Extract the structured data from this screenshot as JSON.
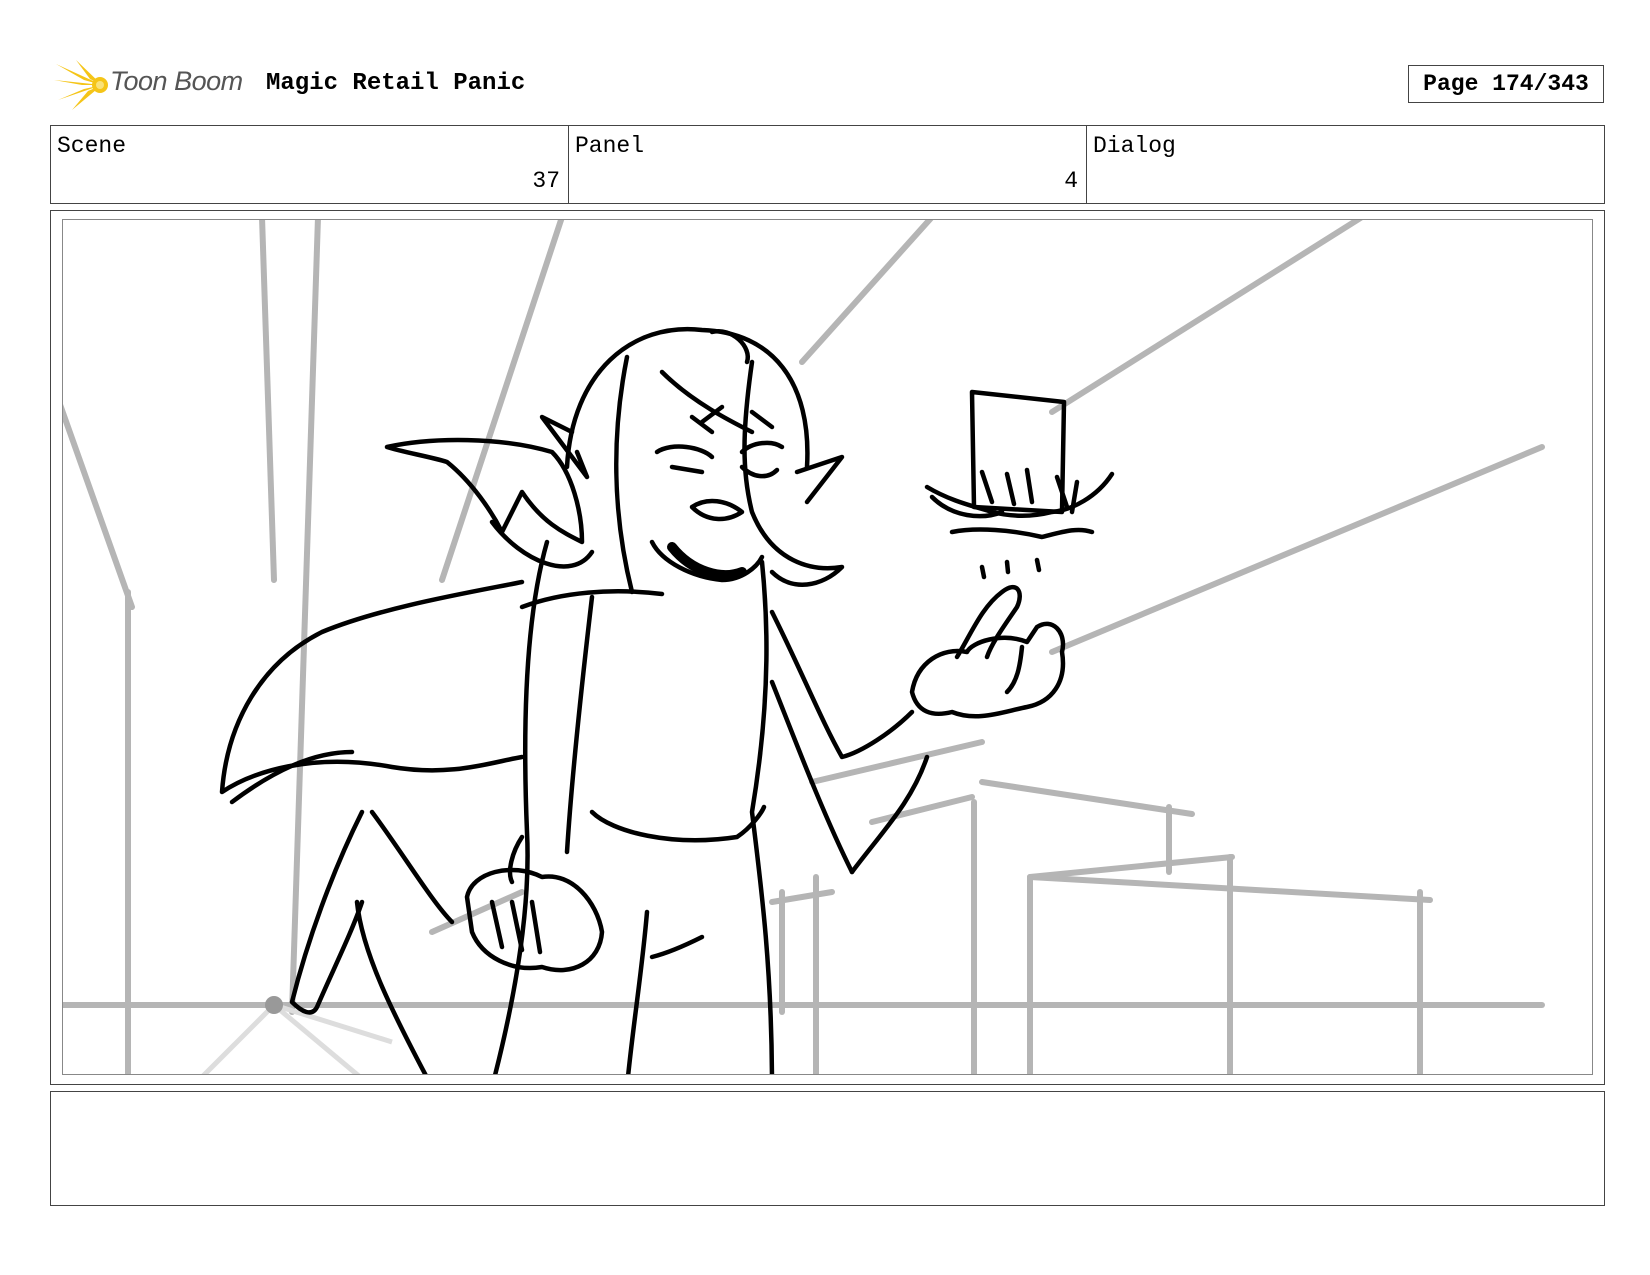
{
  "header": {
    "brand": "Toon Boom",
    "project_title": "Magic Retail Panic",
    "page_label": "Page 174/343"
  },
  "fields": {
    "scene_label": "Scene",
    "scene_value": "37",
    "panel_label": "Panel",
    "panel_value": "4",
    "dialog_label": "Dialog",
    "dialog_value": ""
  },
  "notes": {
    "text": ""
  },
  "colors": {
    "logo_accent": "#f5c518",
    "sketch_gray": "#b5b5b5",
    "ink": "#000000"
  }
}
